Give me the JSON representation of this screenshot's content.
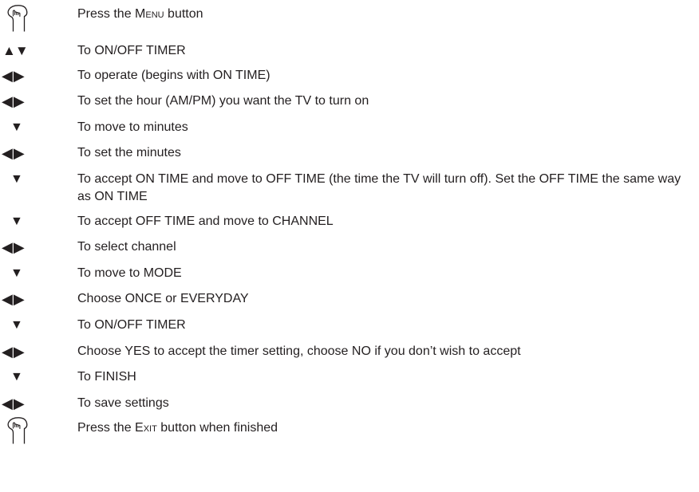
{
  "steps": [
    {
      "icon": "hand-press-icon",
      "pre": "Press the ",
      "sc": "Menu",
      "post": " button"
    },
    {
      "icon": "up-down-arrows-icon",
      "glyph": "▲▼",
      "text": "To ON/OFF TIMER"
    },
    {
      "icon": "left-right-arrows-icon",
      "glyph": "◀▶",
      "text": "To operate (begins with ON TIME)"
    },
    {
      "icon": "left-right-arrows-icon",
      "glyph": "◀▶",
      "text": "To set the hour (AM/PM) you want the TV to turn on"
    },
    {
      "icon": "down-arrow-icon",
      "glyph": "▼",
      "text": "To move to minutes"
    },
    {
      "icon": "left-right-arrows-icon",
      "glyph": "◀▶",
      "text": "To set the minutes"
    },
    {
      "icon": "down-arrow-icon",
      "glyph": "▼",
      "text": "To accept ON TIME and move to OFF TIME (the time the TV will turn off). Set the OFF TIME the same way as ON TIME"
    },
    {
      "icon": "down-arrow-icon",
      "glyph": "▼",
      "text": "To accept OFF TIME and move to CHANNEL"
    },
    {
      "icon": "left-right-arrows-icon",
      "glyph": "◀▶",
      "text": "To select channel"
    },
    {
      "icon": "down-arrow-icon",
      "glyph": "▼",
      "text": "To move to MODE"
    },
    {
      "icon": "left-right-arrows-icon",
      "glyph": "◀▶",
      "text": "Choose ONCE or EVERYDAY"
    },
    {
      "icon": "down-arrow-icon",
      "glyph": "▼",
      "text": "To ON/OFF TIMER"
    },
    {
      "icon": "left-right-arrows-icon",
      "glyph": "◀▶",
      "text": "Choose YES to accept the timer setting, choose NO if you don’t wish to accept"
    },
    {
      "icon": "down-arrow-icon",
      "glyph": "▼",
      "text": "To FINISH"
    },
    {
      "icon": "left-right-arrows-icon",
      "glyph": "◀▶",
      "text": "To save settings"
    },
    {
      "icon": "hand-press-icon",
      "pre": "Press the ",
      "sc": "Exit",
      "post": " button when finished"
    }
  ]
}
